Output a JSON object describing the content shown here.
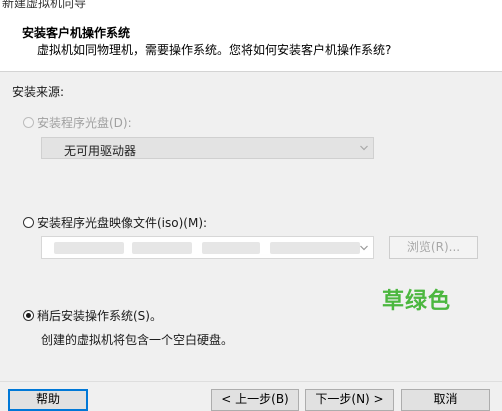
{
  "window": {
    "title": "新建虚拟机向导"
  },
  "header": {
    "title": "安装客户机操作系统",
    "subtitle": "虚拟机如同物理机，需要操作系统。您将如何安装客户机操作系统?"
  },
  "install_source": {
    "label": "安装来源:",
    "disc_option": {
      "label": "安装程序光盘(D):",
      "enabled": false,
      "selected": false,
      "drive_value": "无可用驱动器"
    },
    "iso_option": {
      "label": "安装程序光盘映像文件(iso)(M):",
      "selected": false,
      "path_value": "",
      "browse_label": "浏览(R)..."
    },
    "later_option": {
      "label": "稍后安装操作系统(S)。",
      "selected": true,
      "description": "创建的虚拟机将包含一个空白硬盘。"
    }
  },
  "watermark": "草绿色",
  "footer": {
    "help_label": "帮助",
    "back_label": "< 上一步(B)",
    "next_label": "下一步(N) >",
    "cancel_label": "取消"
  },
  "colors": {
    "accent": "#0078d7",
    "watermark": "#4cb73f",
    "disabled_text": "#a0a0a0"
  }
}
